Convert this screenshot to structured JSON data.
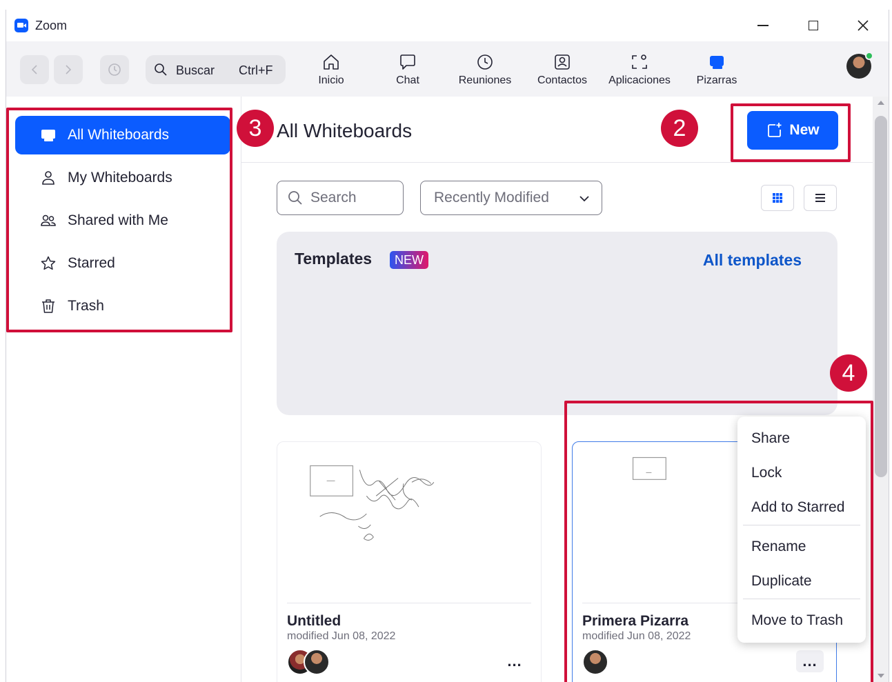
{
  "window": {
    "title": "Zoom"
  },
  "toolbar": {
    "search_label": "Buscar",
    "search_shortcut": "Ctrl+F",
    "items": [
      {
        "label": "Inicio",
        "icon": "home-icon"
      },
      {
        "label": "Chat",
        "icon": "chat-icon"
      },
      {
        "label": "Reuniones",
        "icon": "clock-icon"
      },
      {
        "label": "Contactos",
        "icon": "contacts-icon"
      },
      {
        "label": "Aplicaciones",
        "icon": "apps-icon"
      },
      {
        "label": "Pizarras",
        "icon": "whiteboard-icon"
      }
    ]
  },
  "sidebar": {
    "items": [
      {
        "label": "All Whiteboards",
        "icon": "whiteboard-icon",
        "active": true
      },
      {
        "label": "My Whiteboards",
        "icon": "person-icon"
      },
      {
        "label": "Shared with Me",
        "icon": "people-icon"
      },
      {
        "label": "Starred",
        "icon": "star-icon"
      },
      {
        "label": "Trash",
        "icon": "trash-icon"
      }
    ]
  },
  "main": {
    "title": "All Whiteboards",
    "new_label": "New",
    "search_placeholder": "Search",
    "sort_label": "Recently Modified",
    "templates": {
      "title": "Templates",
      "badge": "NEW",
      "link": "All templates"
    },
    "cards": [
      {
        "title": "Untitled",
        "modified": "modified Jun 08, 2022",
        "more": "..."
      },
      {
        "title": "Primera Pizarra",
        "modified": "modified Jun 08, 2022",
        "more": "..."
      }
    ]
  },
  "context_menu": {
    "items": [
      "Share",
      "Lock",
      "Add to Starred",
      "Rename",
      "Duplicate",
      "Move to Trash"
    ]
  },
  "annotations": {
    "n2": "2",
    "n3": "3",
    "n4": "4"
  },
  "colors": {
    "accent": "#0b5cff",
    "annotation": "#d0103a",
    "link": "#0e56c9"
  }
}
